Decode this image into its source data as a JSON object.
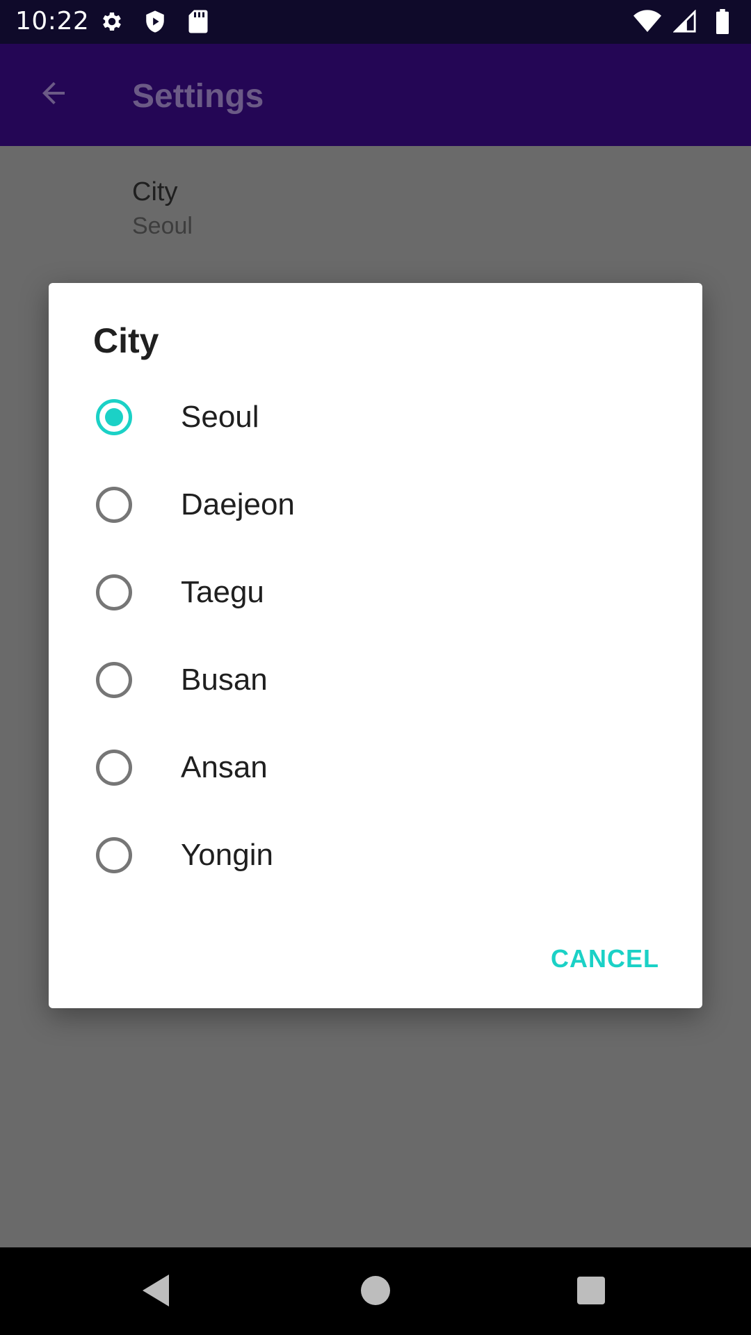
{
  "status_bar": {
    "time": "10:22",
    "left_icons": [
      "settings-icon",
      "shield-icon",
      "sd-card-icon"
    ],
    "right_icons": [
      "wifi-icon",
      "signal-icon",
      "battery-icon"
    ]
  },
  "app_bar": {
    "title": "Settings",
    "back_icon": "arrow-back-icon",
    "color": "#240655"
  },
  "preference": {
    "title": "City",
    "summary": "Seoul"
  },
  "dialog": {
    "title": "City",
    "options": [
      {
        "label": "Seoul",
        "checked": true
      },
      {
        "label": "Daejeon",
        "checked": false
      },
      {
        "label": "Taegu",
        "checked": false
      },
      {
        "label": "Busan",
        "checked": false
      },
      {
        "label": "Ansan",
        "checked": false
      },
      {
        "label": "Yongin",
        "checked": false
      }
    ],
    "cancel_label": "CANCEL",
    "accent_color": "#1bd1c6"
  },
  "nav_bar": {
    "buttons": [
      "back-triangle-icon",
      "home-circle-icon",
      "recents-square-icon"
    ]
  }
}
